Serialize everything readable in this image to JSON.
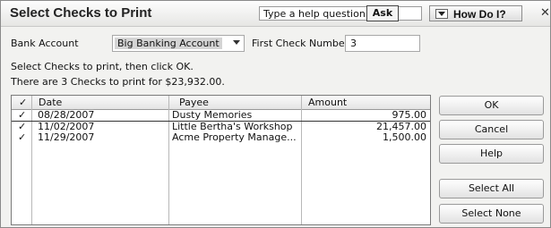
{
  "dialog": {
    "title": "Select Checks to Print",
    "help_question": "Type a help question",
    "ask_label": "Ask",
    "how_do_label": "How Do I?",
    "close_glyph": "✕"
  },
  "form": {
    "bank_account_label": "Bank Account",
    "bank_account_value": "Big Banking Account",
    "first_check_label": "First Check Number",
    "first_check_value": "3",
    "instruction": "Select Checks to print, then click OK.",
    "summary": "There are 3 Checks to print for $23,932.00."
  },
  "table": {
    "headers": {
      "check": "✓",
      "date": "Date",
      "payee": "Payee",
      "amount": "Amount"
    },
    "rows": [
      {
        "check": "✓",
        "date": "08/28/2007",
        "payee": "Dusty Memories",
        "amount": "975.00"
      },
      {
        "check": "✓",
        "date": "11/02/2007",
        "payee": "Little Bertha's Workshop",
        "amount": "21,457.00"
      },
      {
        "check": "✓",
        "date": "11/29/2007",
        "payee": "Acme Property Manage...",
        "amount": "1,500.00"
      }
    ]
  },
  "buttons": {
    "ok": "OK",
    "cancel": "Cancel",
    "help": "Help",
    "select_all": "Select All",
    "select_none": "Select None"
  }
}
